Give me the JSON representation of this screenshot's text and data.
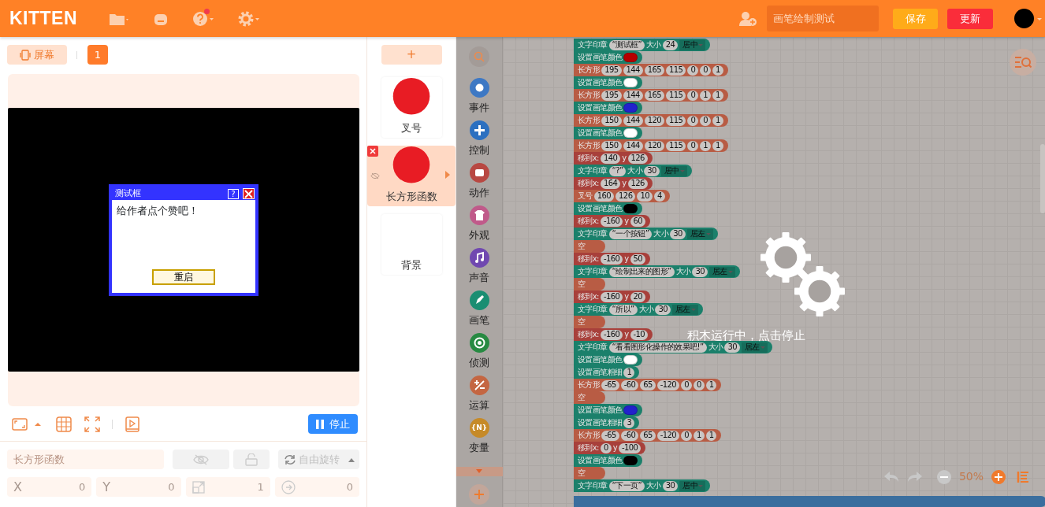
{
  "header": {
    "logo": "KITTEN",
    "help_notification": true,
    "project_name": "画笔绘制测试",
    "save": "保存",
    "update": "更新"
  },
  "stage_panel": {
    "screen_button": "屏幕",
    "screen_number": "1",
    "dialog": {
      "title": "测试框",
      "help": "?",
      "message": "给作者点个赞吧！",
      "button": "重启"
    },
    "stop_button": "停止",
    "sprite_name_placeholder": "长方形函数",
    "rotation_mode": "自由旋转",
    "fields": [
      {
        "kind": "text",
        "label": "X",
        "value": "0"
      },
      {
        "kind": "text",
        "label": "Y",
        "value": "0"
      },
      {
        "kind": "size",
        "value": "1"
      },
      {
        "kind": "direction",
        "value": "0"
      }
    ]
  },
  "sprites": {
    "add": "+",
    "items": [
      {
        "name": "叉号",
        "kind": "circle",
        "selected": false
      },
      {
        "name": "长方形函数",
        "kind": "circle",
        "selected": true
      },
      {
        "name": "背景",
        "kind": "blank",
        "selected": false
      }
    ]
  },
  "categories": [
    {
      "name": "事件",
      "color": "#3d78c4"
    },
    {
      "name": "控制",
      "color": "#2c70c0"
    },
    {
      "name": "动作",
      "color": "#b84842"
    },
    {
      "name": "外观",
      "color": "#c05a8a"
    },
    {
      "name": "声音",
      "color": "#7048b0"
    },
    {
      "name": "画笔",
      "color": "#1a8e72"
    },
    {
      "name": "侦测",
      "color": "#278a42"
    },
    {
      "name": "运算",
      "color": "#c46642"
    },
    {
      "name": "变量",
      "color": "#c68a28",
      "badge": "{N}"
    }
  ],
  "workspace": {
    "running_message": "积木运行中，点击停止",
    "zoom": "50%",
    "blocks": [
      {
        "kind": "pen",
        "parts": [
          {
            "kind": "label",
            "text": "文字印章"
          },
          {
            "kind": "value",
            "text": "“测试框”"
          },
          {
            "kind": "label",
            "text": "大小"
          },
          {
            "kind": "value",
            "text": "24"
          },
          {
            "kind": "dropdown",
            "text": "居中"
          }
        ]
      },
      {
        "kind": "pen",
        "parts": [
          {
            "kind": "label",
            "text": "设置画笔颜色"
          },
          {
            "kind": "swatch",
            "color": "#b50000"
          }
        ]
      },
      {
        "kind": "shape",
        "parts": [
          {
            "kind": "label",
            "text": "长方形"
          },
          {
            "kind": "value",
            "text": "195"
          },
          {
            "kind": "value",
            "text": "144"
          },
          {
            "kind": "value",
            "text": "165"
          },
          {
            "kind": "value",
            "text": "115"
          },
          {
            "kind": "value",
            "text": "0"
          },
          {
            "kind": "value",
            "text": "0"
          },
          {
            "kind": "value",
            "text": "1"
          }
        ]
      },
      {
        "kind": "pen",
        "parts": [
          {
            "kind": "label",
            "text": "设置画笔颜色"
          },
          {
            "kind": "swatch",
            "color": "#ffffff"
          }
        ]
      },
      {
        "kind": "shape",
        "parts": [
          {
            "kind": "label",
            "text": "长方形"
          },
          {
            "kind": "value",
            "text": "195"
          },
          {
            "kind": "value",
            "text": "144"
          },
          {
            "kind": "value",
            "text": "165"
          },
          {
            "kind": "value",
            "text": "115"
          },
          {
            "kind": "value",
            "text": "0"
          },
          {
            "kind": "value",
            "text": "1"
          },
          {
            "kind": "value",
            "text": "1"
          }
        ]
      },
      {
        "kind": "pen",
        "parts": [
          {
            "kind": "label",
            "text": "设置画笔颜色"
          },
          {
            "kind": "swatch",
            "color": "#2222cc"
          }
        ]
      },
      {
        "kind": "shape",
        "parts": [
          {
            "kind": "label",
            "text": "长方形"
          },
          {
            "kind": "value",
            "text": "150"
          },
          {
            "kind": "value",
            "text": "144"
          },
          {
            "kind": "value",
            "text": "120"
          },
          {
            "kind": "value",
            "text": "115"
          },
          {
            "kind": "value",
            "text": "0"
          },
          {
            "kind": "value",
            "text": "0"
          },
          {
            "kind": "value",
            "text": "1"
          }
        ]
      },
      {
        "kind": "pen",
        "parts": [
          {
            "kind": "label",
            "text": "设置画笔颜色"
          },
          {
            "kind": "swatch",
            "color": "#ffffff"
          }
        ]
      },
      {
        "kind": "shape",
        "parts": [
          {
            "kind": "label",
            "text": "长方形"
          },
          {
            "kind": "value",
            "text": "150"
          },
          {
            "kind": "value",
            "text": "144"
          },
          {
            "kind": "value",
            "text": "120"
          },
          {
            "kind": "value",
            "text": "115"
          },
          {
            "kind": "value",
            "text": "0"
          },
          {
            "kind": "value",
            "text": "1"
          },
          {
            "kind": "value",
            "text": "1"
          }
        ]
      },
      {
        "kind": "motion",
        "parts": [
          {
            "kind": "label",
            "text": "移到x:"
          },
          {
            "kind": "value",
            "text": "140"
          },
          {
            "kind": "label",
            "text": "y"
          },
          {
            "kind": "value",
            "text": "126"
          }
        ]
      },
      {
        "kind": "pen",
        "parts": [
          {
            "kind": "label",
            "text": "文字印章"
          },
          {
            "kind": "value",
            "text": "“?”"
          },
          {
            "kind": "label",
            "text": "大小"
          },
          {
            "kind": "value",
            "text": "30"
          },
          {
            "kind": "dropdown",
            "text": "居中"
          }
        ]
      },
      {
        "kind": "motion",
        "parts": [
          {
            "kind": "label",
            "text": "移到x:"
          },
          {
            "kind": "value",
            "text": "164"
          },
          {
            "kind": "label",
            "text": "y"
          },
          {
            "kind": "value",
            "text": "126"
          }
        ]
      },
      {
        "kind": "shape",
        "parts": [
          {
            "kind": "label",
            "text": "叉号"
          },
          {
            "kind": "value",
            "text": "160"
          },
          {
            "kind": "value",
            "text": "126"
          },
          {
            "kind": "value",
            "text": "10"
          },
          {
            "kind": "value",
            "text": "4"
          }
        ]
      },
      {
        "kind": "pen",
        "parts": [
          {
            "kind": "label",
            "text": "设置画笔颜色"
          },
          {
            "kind": "swatch",
            "color": "#000000"
          }
        ]
      },
      {
        "kind": "motion",
        "parts": [
          {
            "kind": "label",
            "text": "移到x:"
          },
          {
            "kind": "value",
            "text": "-160"
          },
          {
            "kind": "label",
            "text": "y"
          },
          {
            "kind": "value",
            "text": "60"
          }
        ]
      },
      {
        "kind": "pen",
        "parts": [
          {
            "kind": "label",
            "text": "文字印章"
          },
          {
            "kind": "value",
            "text": "“一个按钮”"
          },
          {
            "kind": "label",
            "text": "大小"
          },
          {
            "kind": "value",
            "text": "30"
          },
          {
            "kind": "dropdown",
            "text": "居左"
          }
        ]
      },
      {
        "kind": "shape",
        "parts": [
          {
            "kind": "label",
            "text": "空"
          }
        ]
      },
      {
        "kind": "motion",
        "parts": [
          {
            "kind": "label",
            "text": "移到x:"
          },
          {
            "kind": "value",
            "text": "-160"
          },
          {
            "kind": "label",
            "text": "y"
          },
          {
            "kind": "value",
            "text": "50"
          }
        ]
      },
      {
        "kind": "pen",
        "parts": [
          {
            "kind": "label",
            "text": "文字印章"
          },
          {
            "kind": "value",
            "text": "“绘制出来的图形”"
          },
          {
            "kind": "label",
            "text": "大小"
          },
          {
            "kind": "value",
            "text": "30"
          },
          {
            "kind": "dropdown",
            "text": "居左"
          }
        ]
      },
      {
        "kind": "shape",
        "parts": [
          {
            "kind": "label",
            "text": "空"
          }
        ]
      },
      {
        "kind": "motion",
        "parts": [
          {
            "kind": "label",
            "text": "移到x:"
          },
          {
            "kind": "value",
            "text": "-160"
          },
          {
            "kind": "label",
            "text": "y"
          },
          {
            "kind": "value",
            "text": "20"
          }
        ]
      },
      {
        "kind": "pen",
        "parts": [
          {
            "kind": "label",
            "text": "文字印章"
          },
          {
            "kind": "value",
            "text": "“所以”"
          },
          {
            "kind": "label",
            "text": "大小"
          },
          {
            "kind": "value",
            "text": "30"
          },
          {
            "kind": "dropdown",
            "text": "居左"
          }
        ]
      },
      {
        "kind": "shape",
        "parts": [
          {
            "kind": "label",
            "text": "空"
          }
        ]
      },
      {
        "kind": "motion",
        "parts": [
          {
            "kind": "label",
            "text": "移到x:"
          },
          {
            "kind": "value",
            "text": "-160"
          },
          {
            "kind": "label",
            "text": "y"
          },
          {
            "kind": "value",
            "text": "-10"
          }
        ]
      },
      {
        "kind": "pen",
        "parts": [
          {
            "kind": "label",
            "text": "文字印章"
          },
          {
            "kind": "value",
            "text": "“看看图形化操作的效果吧!”"
          },
          {
            "kind": "label",
            "text": "大小"
          },
          {
            "kind": "value",
            "text": "30"
          },
          {
            "kind": "dropdown",
            "text": "居左"
          }
        ]
      },
      {
        "kind": "pen",
        "parts": [
          {
            "kind": "label",
            "text": "设置画笔颜色"
          },
          {
            "kind": "swatch",
            "color": "#ffffff"
          }
        ]
      },
      {
        "kind": "pen",
        "parts": [
          {
            "kind": "label",
            "text": "设置画笔粗细"
          },
          {
            "kind": "value",
            "text": "1"
          }
        ]
      },
      {
        "kind": "shape",
        "parts": [
          {
            "kind": "label",
            "text": "长方形"
          },
          {
            "kind": "value",
            "text": "-65"
          },
          {
            "kind": "value",
            "text": "-60"
          },
          {
            "kind": "value",
            "text": "65"
          },
          {
            "kind": "value",
            "text": "-120"
          },
          {
            "kind": "value",
            "text": "0"
          },
          {
            "kind": "value",
            "text": "0"
          },
          {
            "kind": "value",
            "text": "1"
          }
        ]
      },
      {
        "kind": "shape",
        "parts": [
          {
            "kind": "label",
            "text": "空"
          }
        ]
      },
      {
        "kind": "pen",
        "parts": [
          {
            "kind": "label",
            "text": "设置画笔颜色"
          },
          {
            "kind": "swatch",
            "color": "#2222cc"
          }
        ]
      },
      {
        "kind": "pen",
        "parts": [
          {
            "kind": "label",
            "text": "设置画笔粗细"
          },
          {
            "kind": "value",
            "text": "3"
          }
        ]
      },
      {
        "kind": "shape",
        "parts": [
          {
            "kind": "label",
            "text": "长方形"
          },
          {
            "kind": "value",
            "text": "-65"
          },
          {
            "kind": "value",
            "text": "-60"
          },
          {
            "kind": "value",
            "text": "65"
          },
          {
            "kind": "value",
            "text": "-120"
          },
          {
            "kind": "value",
            "text": "0"
          },
          {
            "kind": "value",
            "text": "1"
          },
          {
            "kind": "value",
            "text": "1"
          }
        ]
      },
      {
        "kind": "motion",
        "parts": [
          {
            "kind": "label",
            "text": "移到x:"
          },
          {
            "kind": "value",
            "text": "0"
          },
          {
            "kind": "label",
            "text": "y"
          },
          {
            "kind": "value",
            "text": "-100"
          }
        ]
      },
      {
        "kind": "pen",
        "parts": [
          {
            "kind": "label",
            "text": "设置画笔颜色"
          },
          {
            "kind": "swatch",
            "color": "#000000"
          }
        ]
      },
      {
        "kind": "shape",
        "parts": [
          {
            "kind": "label",
            "text": "空"
          }
        ]
      },
      {
        "kind": "pen",
        "parts": [
          {
            "kind": "label",
            "text": "文字印章"
          },
          {
            "kind": "value",
            "text": "“下一页”"
          },
          {
            "kind": "label",
            "text": "大小"
          },
          {
            "kind": "value",
            "text": "30"
          },
          {
            "kind": "dropdown",
            "text": "居中"
          }
        ]
      }
    ]
  }
}
